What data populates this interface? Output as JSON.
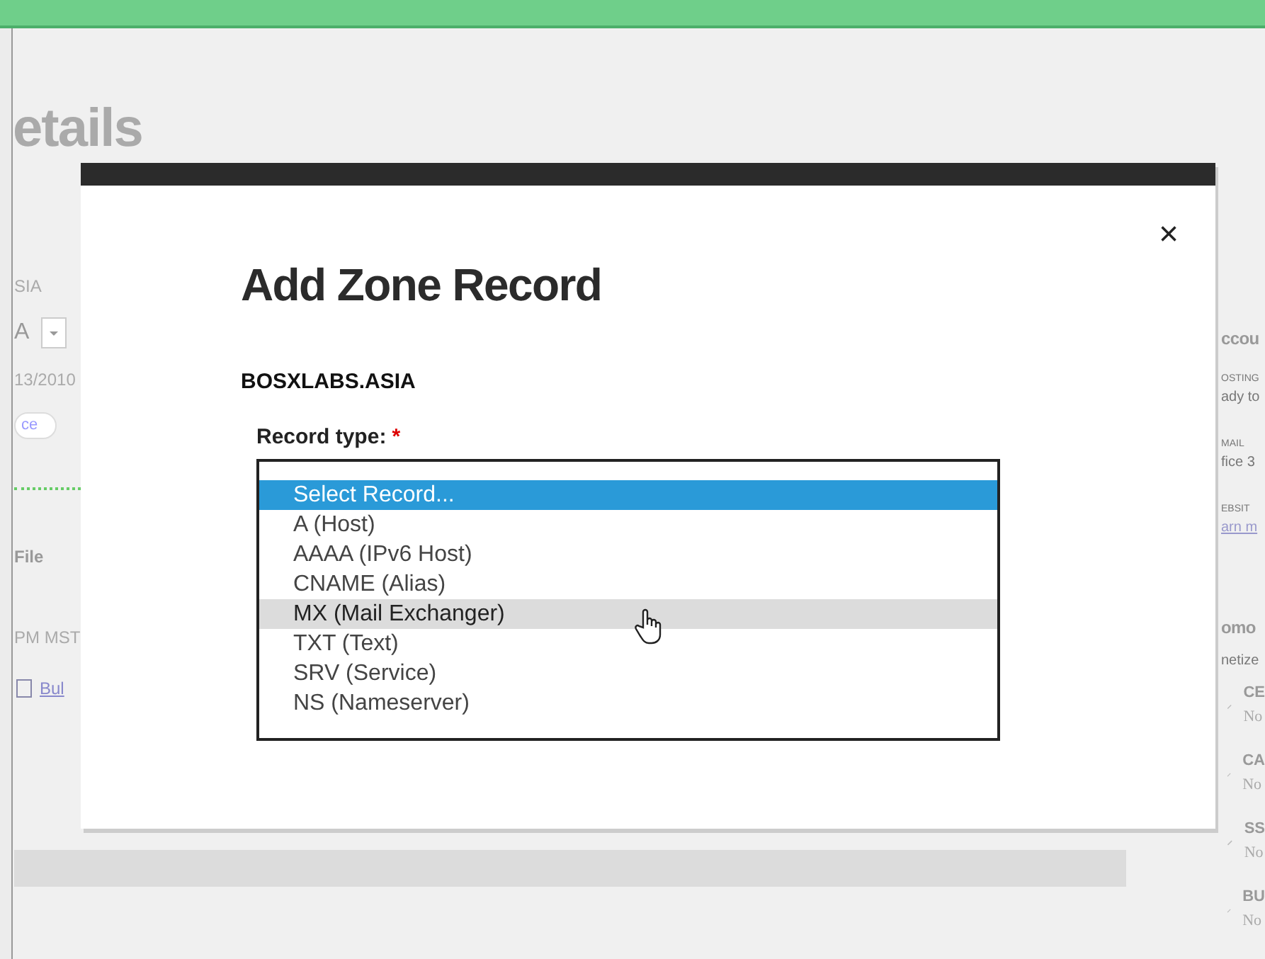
{
  "page": {
    "title": "etails",
    "left_fragments": [
      {
        "kind": "text",
        "text": "SIA"
      },
      {
        "kind": "select",
        "text": "A"
      },
      {
        "kind": "text",
        "text": "13/2010"
      },
      {
        "kind": "pill",
        "text": "ce"
      },
      {
        "kind": "divider"
      },
      {
        "kind": "bold",
        "text": "File"
      },
      {
        "kind": "text",
        "text": "PM MST"
      },
      {
        "kind": "link",
        "text": "Bul"
      }
    ],
    "right_fragments": [
      {
        "kind": "heading",
        "text": "ccou"
      },
      {
        "kind": "label",
        "text": "OSTING"
      },
      {
        "kind": "text",
        "text": "ady to"
      },
      {
        "kind": "label",
        "text": "MAIL"
      },
      {
        "kind": "text",
        "text": "fice 3"
      },
      {
        "kind": "label",
        "text": "EBSIT"
      },
      {
        "kind": "link",
        "text": "arn m"
      },
      {
        "kind": "heading",
        "text": "omo"
      },
      {
        "kind": "text",
        "text": "netize"
      },
      {
        "kind": "feature",
        "text": "CE",
        "sub": "No"
      },
      {
        "kind": "feature",
        "text": "CA",
        "sub": "No"
      },
      {
        "kind": "feature",
        "text": "SS",
        "sub": "No"
      },
      {
        "kind": "feature",
        "text": "BU",
        "sub": "No"
      }
    ]
  },
  "dialog": {
    "close": "×",
    "title": "Add Zone Record",
    "domain": "BOSXLABS.ASIA",
    "field_label": "Record type:",
    "required_mark": "*",
    "options": [
      {
        "label": "Select Record...",
        "selected": true,
        "hovered": false
      },
      {
        "label": "A (Host)",
        "selected": false,
        "hovered": false
      },
      {
        "label": "AAAA (IPv6 Host)",
        "selected": false,
        "hovered": false
      },
      {
        "label": "CNAME (Alias)",
        "selected": false,
        "hovered": false
      },
      {
        "label": "MX (Mail Exchanger)",
        "selected": false,
        "hovered": true
      },
      {
        "label": "TXT (Text)",
        "selected": false,
        "hovered": false
      },
      {
        "label": "SRV (Service)",
        "selected": false,
        "hovered": false
      },
      {
        "label": "NS (Nameserver)",
        "selected": false,
        "hovered": false
      }
    ]
  }
}
